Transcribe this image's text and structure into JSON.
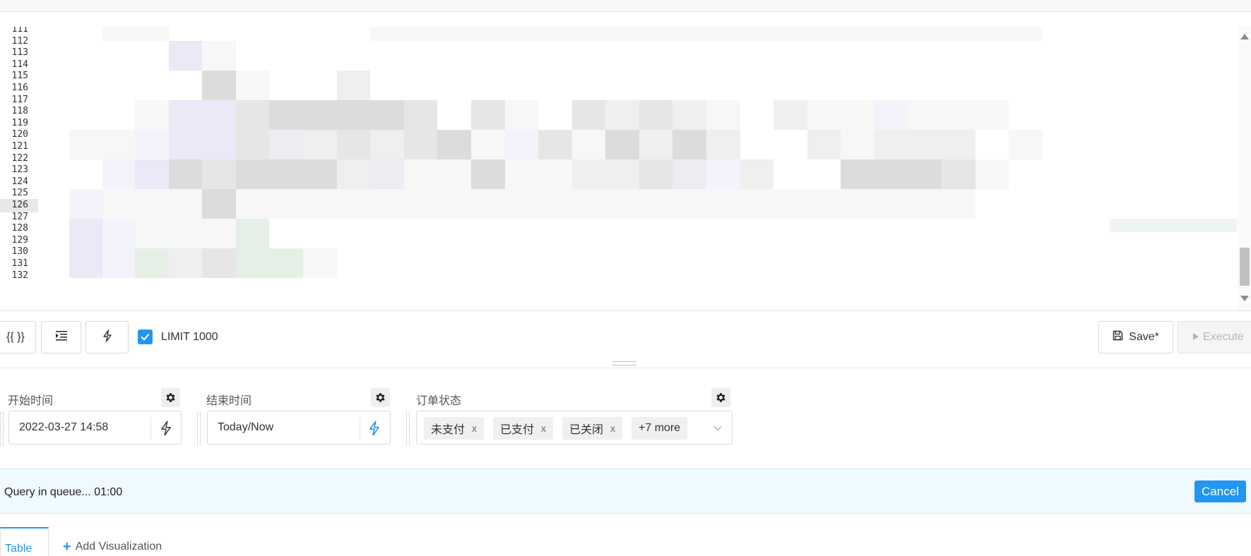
{
  "editor": {
    "line_numbers": [
      "111",
      "112",
      "113",
      "114",
      "115",
      "116",
      "117",
      "118",
      "119",
      "120",
      "121",
      "122",
      "123",
      "124",
      "125",
      "126",
      "127",
      "128",
      "129",
      "130",
      "131",
      "132"
    ],
    "active_line": "126"
  },
  "toolbar": {
    "format_label": "{{ }}",
    "limit_label": "LIMIT 1000",
    "limit_checked": true,
    "save_label": "Save*",
    "execute_label": "Execute"
  },
  "params": {
    "start": {
      "label": "开始时间",
      "value": "2022-03-27 14:58"
    },
    "end": {
      "label": "结束时间",
      "value": "Today/Now"
    },
    "status": {
      "label": "订单状态",
      "tags": [
        "未支付",
        "已支付",
        "已关闭"
      ],
      "more": "+7 more"
    }
  },
  "queue": {
    "text": "Query in queue... 01:00",
    "cancel_label": "Cancel"
  },
  "tabs": {
    "table_label": "Table",
    "add_viz_label": "Add Visualization"
  },
  "colors": {
    "accent": "#2196f3",
    "queue_bg": "#effaff"
  }
}
